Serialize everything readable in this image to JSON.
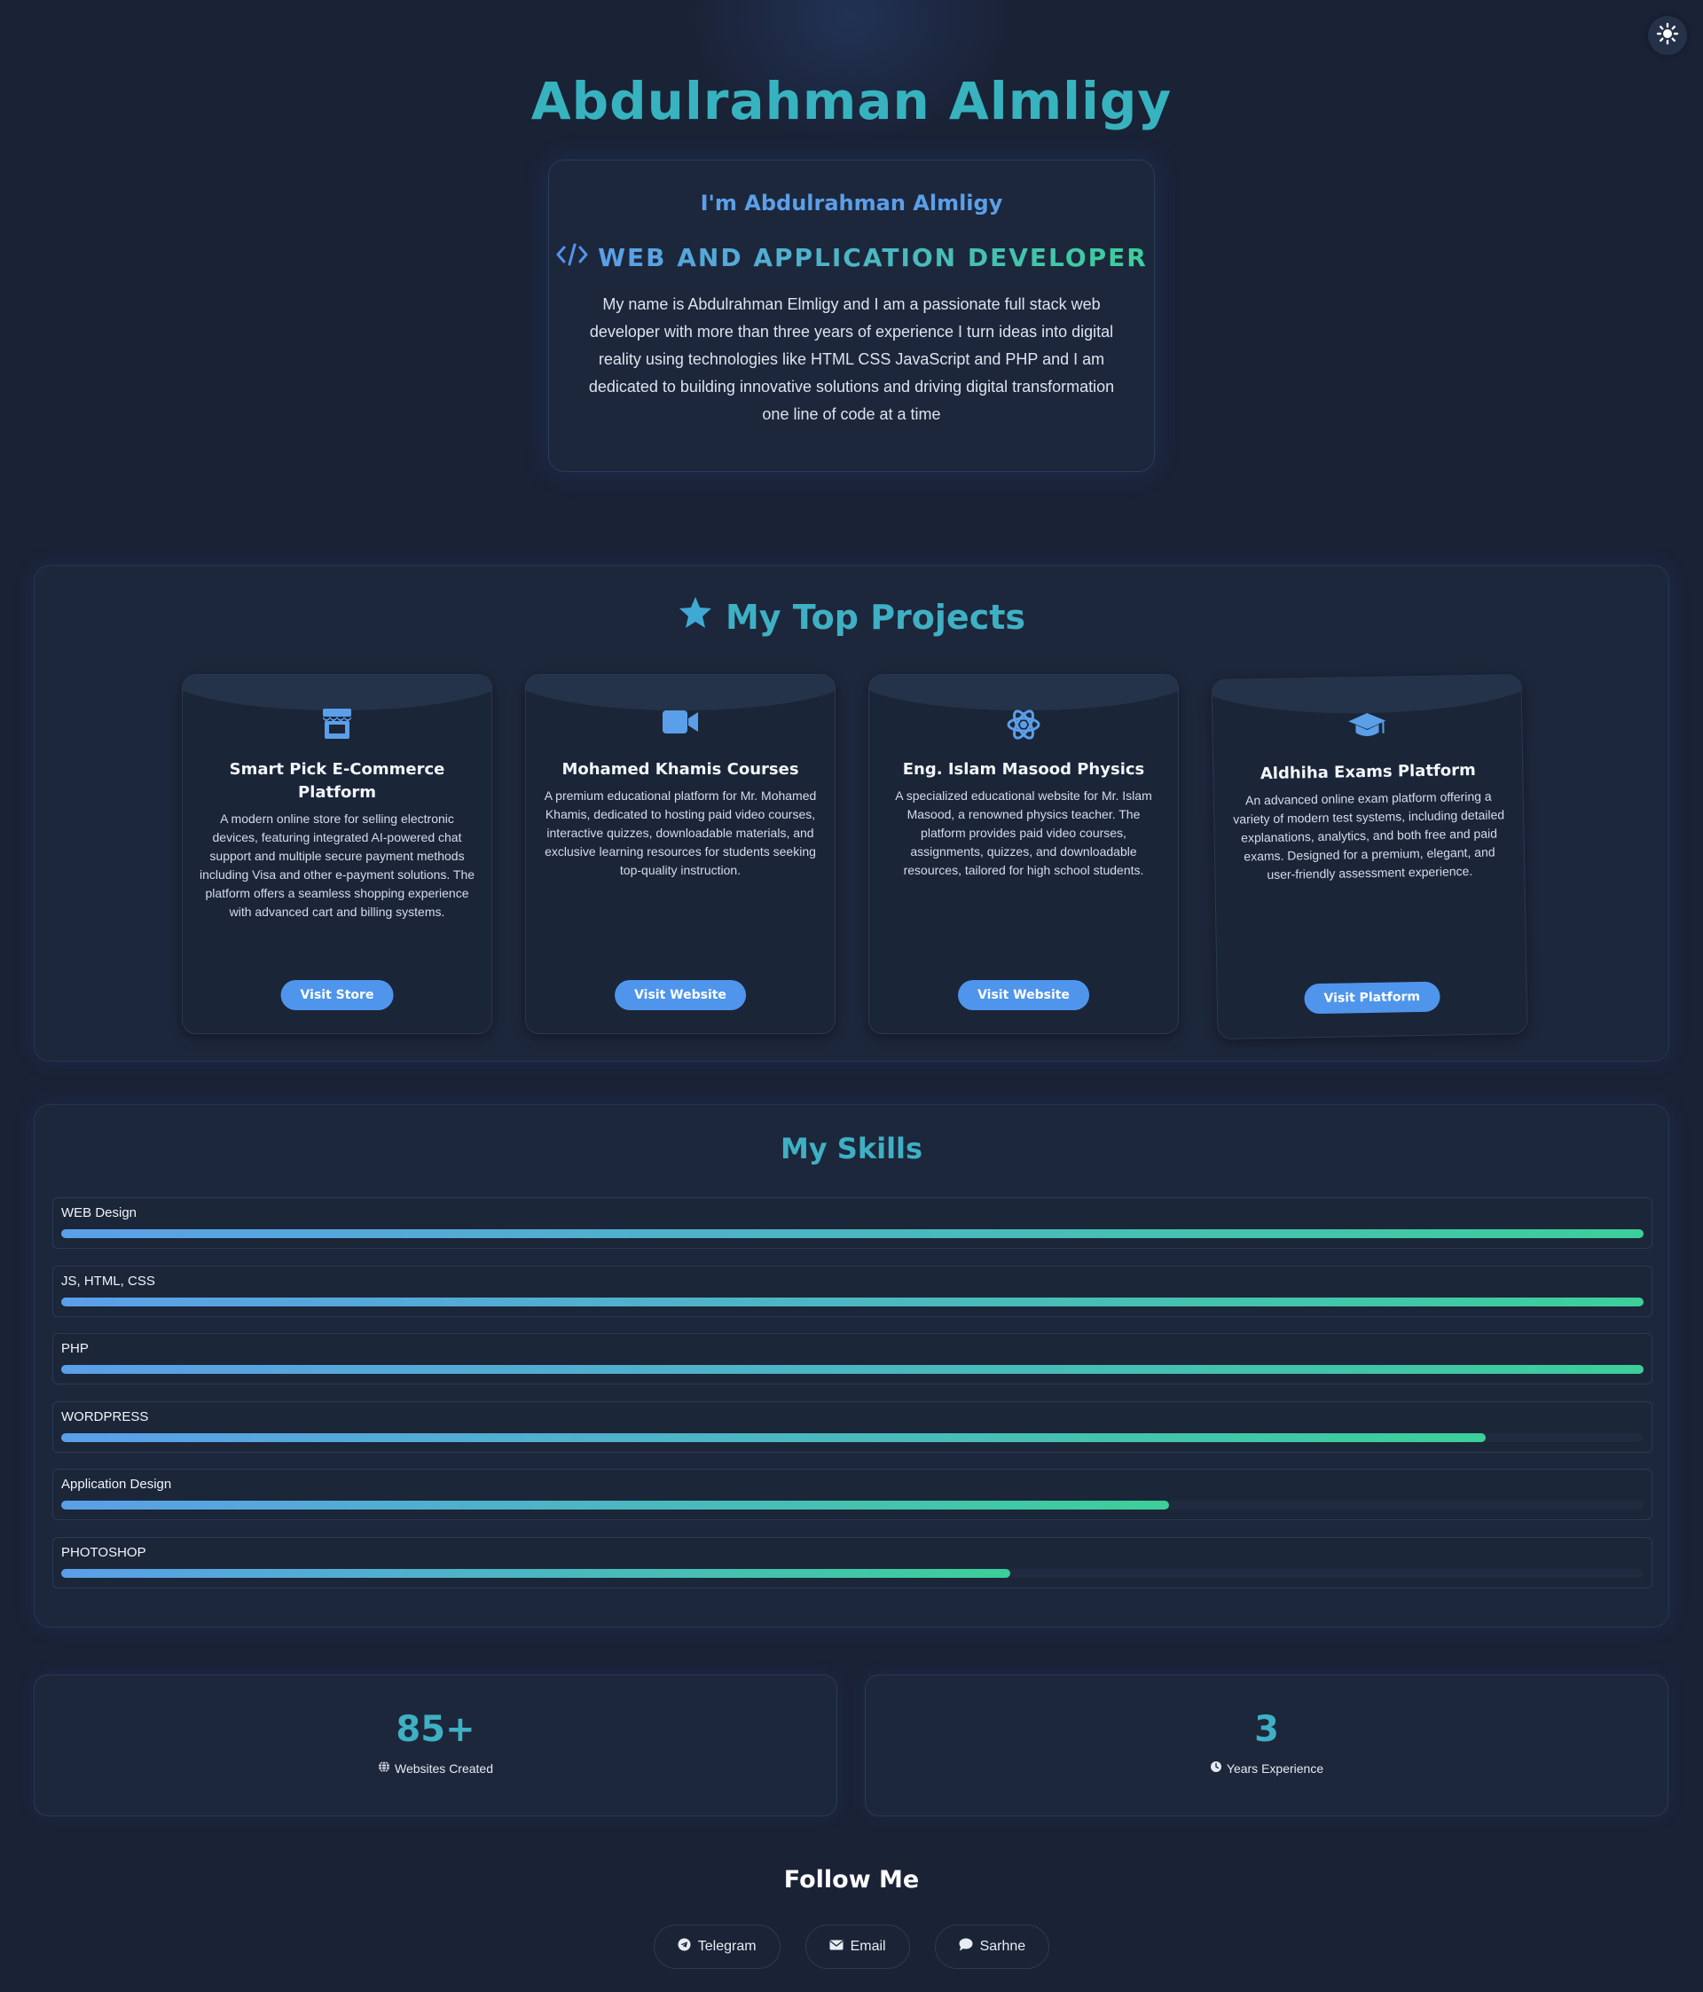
{
  "header": {
    "name": "Abdulrahman Almligy"
  },
  "intro": {
    "greeting": "I'm Abdulrahman Almligy",
    "role": "WEB AND APPLICATION DEVELOPER",
    "description": "My name is Abdulrahman Elmligy and I am a passionate full stack web developer with more than three years of experience I turn ideas into digital reality using technologies like HTML CSS JavaScript and PHP and I am dedicated to building innovative solutions and driving digital transformation one line of code at a time"
  },
  "projects": {
    "heading": "My Top Projects",
    "items": [
      {
        "icon": "store-icon",
        "title": "Smart Pick E-Commerce Platform",
        "description": "A modern online store for selling electronic devices, featuring integrated AI-powered chat support and multiple secure payment methods including Visa and other e-payment solutions. The platform offers a seamless shopping experience with advanced cart and billing systems.",
        "button": "Visit Store"
      },
      {
        "icon": "video-camera-icon",
        "title": "Mohamed Khamis Courses",
        "description": "A premium educational platform for Mr. Mohamed Khamis, dedicated to hosting paid video courses, interactive quizzes, downloadable materials, and exclusive learning resources for students seeking top-quality instruction.",
        "button": "Visit Website"
      },
      {
        "icon": "atom-icon",
        "title": "Eng. Islam Masood Physics",
        "description": "A specialized educational website for Mr. Islam Masood, a renowned physics teacher. The platform provides paid video courses, assignments, quizzes, and downloadable resources, tailored for high school students.",
        "button": "Visit Website"
      },
      {
        "icon": "graduation-cap-icon",
        "title": "Aldhiha Exams Platform",
        "description": "An advanced online exam platform offering a variety of modern test systems, including detailed explanations, analytics, and both free and paid exams. Designed for a premium, elegant, and user-friendly assessment experience.",
        "button": "Visit Platform"
      }
    ]
  },
  "skills": {
    "heading": "My Skills",
    "items": [
      {
        "name": "WEB Design",
        "level": 100
      },
      {
        "name": "JS, HTML, CSS",
        "level": 100
      },
      {
        "name": "PHP",
        "level": 100
      },
      {
        "name": "WORDPRESS",
        "level": 90
      },
      {
        "name": "Application Design",
        "level": 70
      },
      {
        "name": "PHOTOSHOP",
        "level": 60
      }
    ]
  },
  "stats": [
    {
      "value": "85+",
      "label": "Websites Created",
      "icon": "globe-icon"
    },
    {
      "value": "3",
      "label": "Years Experience",
      "icon": "clock-icon"
    }
  ],
  "follow": {
    "heading": "Follow Me",
    "links": [
      {
        "label": "Telegram",
        "icon": "telegram-icon"
      },
      {
        "label": "Email",
        "icon": "envelope-icon"
      },
      {
        "label": "Sarhne",
        "icon": "chat-bubble-icon"
      }
    ]
  },
  "colors": {
    "accent_teal": "#3fb0c4",
    "accent_blue": "#4f95ec",
    "accent_green": "#3ccf9a",
    "background": "#1a2236"
  }
}
